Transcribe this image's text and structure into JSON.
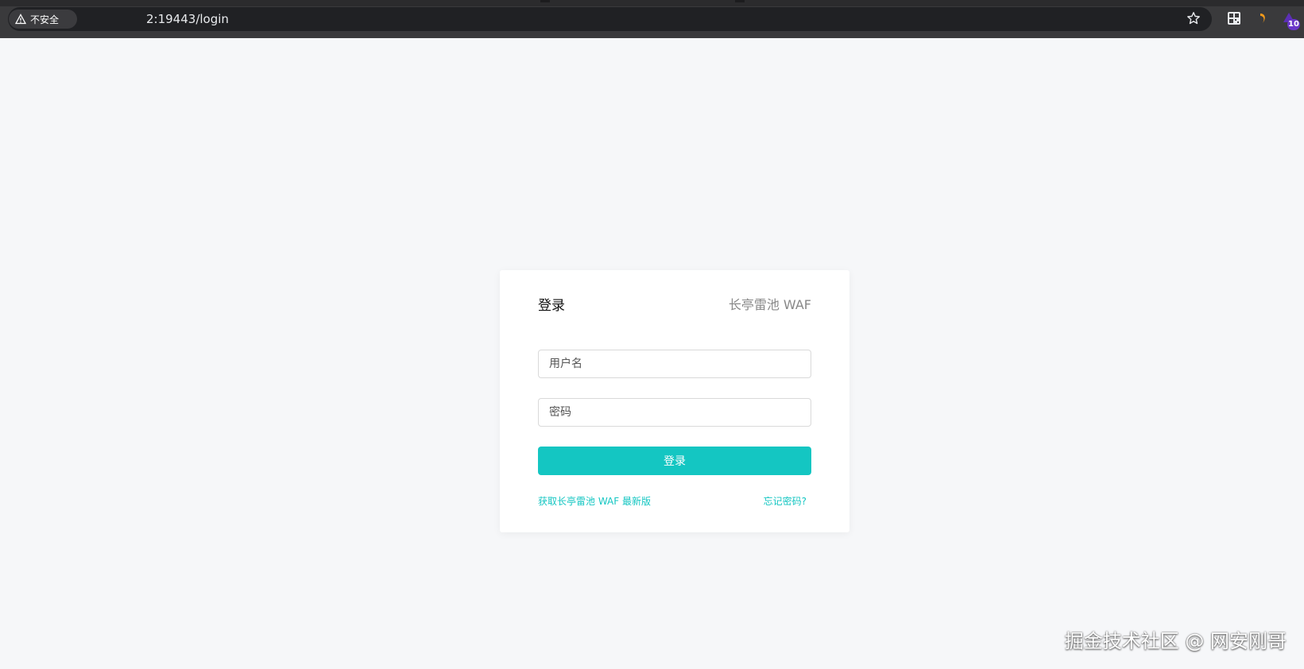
{
  "browser": {
    "security_label": "不安全",
    "url": "2:19443/login",
    "extension_badge": "10",
    "icons": [
      "warning-icon",
      "star-icon",
      "qr-code-icon",
      "orange-extension-icon",
      "purple-extension-icon"
    ]
  },
  "login": {
    "title": "登录",
    "brand": "长亭雷池 WAF",
    "username_placeholder": "用户名",
    "password_placeholder": "密码",
    "submit_label": "登录",
    "get_latest_link": "获取长亭雷池 WAF 最新版",
    "forgot_password_link": "忘记密码?"
  },
  "colors": {
    "accent": "#14c6c2",
    "page_bg": "#f6f7f9"
  },
  "watermark": "掘金技术社区 @ 网安刚哥"
}
